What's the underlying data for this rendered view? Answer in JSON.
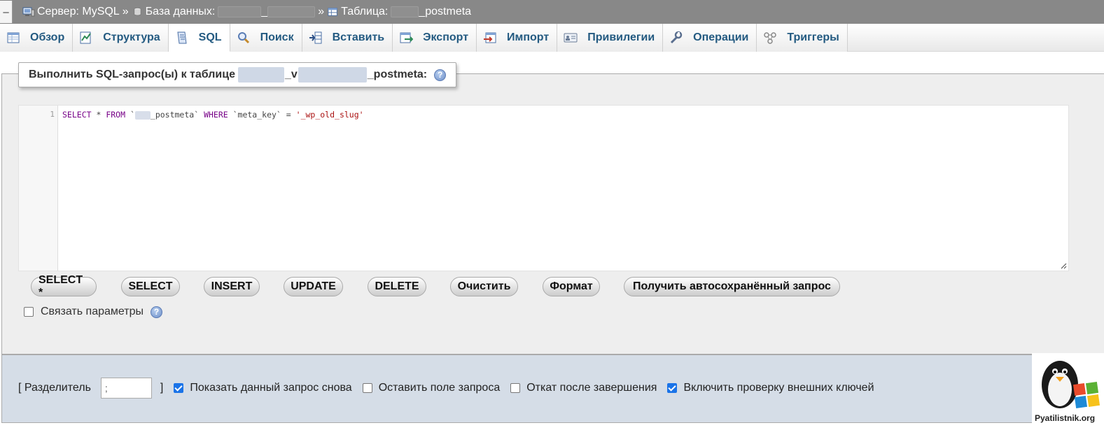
{
  "breadcrumb": {
    "collapse_symbol": "–",
    "server": "Сервер: MySQL",
    "sep1": "»",
    "database_label": "База данных:",
    "database_redacted_mid": "_",
    "sep2": "»",
    "table_label": "Таблица:",
    "table_suffix": "_postmeta"
  },
  "tabs": [
    {
      "label": "Обзор",
      "icon": "browse-icon"
    },
    {
      "label": "Структура",
      "icon": "structure-icon"
    },
    {
      "label": "SQL",
      "icon": "sql-icon",
      "active": true
    },
    {
      "label": "Поиск",
      "icon": "search-icon"
    },
    {
      "label": "Вставить",
      "icon": "insert-icon"
    },
    {
      "label": "Экспорт",
      "icon": "export-icon"
    },
    {
      "label": "Импорт",
      "icon": "import-icon"
    },
    {
      "label": "Привилегии",
      "icon": "privileges-icon"
    },
    {
      "label": "Операции",
      "icon": "operations-icon"
    },
    {
      "label": "Триггеры",
      "icon": "triggers-icon"
    }
  ],
  "query_panel": {
    "legend_prefix": "Выполнить SQL-запрос(ы) к таблице",
    "legend_mid": "_v",
    "legend_suffix": "_postmeta:",
    "help_glyph": "?"
  },
  "editor": {
    "line_number": "1",
    "code": {
      "select": "SELECT",
      "star": " * ",
      "from": "FROM",
      "tick_open": " `",
      "table_suffix": "_postmeta`",
      "where": " WHERE ",
      "column": "`meta_key`",
      "eq": " = ",
      "value": "'_wp_old_slug'"
    }
  },
  "buttons": [
    {
      "label": "SELECT *",
      "name": "select-star-button"
    },
    {
      "label": "SELECT",
      "name": "select-button"
    },
    {
      "label": "INSERT",
      "name": "insert-button"
    },
    {
      "label": "UPDATE",
      "name": "update-button"
    },
    {
      "label": "DELETE",
      "name": "delete-button"
    },
    {
      "label": "Очистить",
      "name": "clear-button"
    },
    {
      "label": "Формат",
      "name": "format-button"
    },
    {
      "label": "Получить автосохранённый запрос",
      "name": "get-autosaved-query-button"
    }
  ],
  "bind_params": {
    "label": "Связать параметры",
    "checked": false
  },
  "options": {
    "delimiter_open": "[ Разделитель",
    "delimiter_value": ";",
    "delimiter_close": "]",
    "show_query_again": {
      "label": "Показать данный запрос снова",
      "checked": true
    },
    "retain_query_box": {
      "label": "Оставить поле запроса",
      "checked": false
    },
    "rollback_on_finish": {
      "label": "Откат после завершения",
      "checked": false
    },
    "foreign_key_checks": {
      "label": "Включить проверку внешних ключей",
      "checked": true
    }
  },
  "watermark": {
    "text": "Pyatilistnik.org"
  },
  "colors": {
    "tab_text": "#235a81",
    "breadcrumb_bg": "#888888",
    "options_bg": "#d5dde7",
    "keyword": "#770088",
    "string": "#aa1111"
  }
}
